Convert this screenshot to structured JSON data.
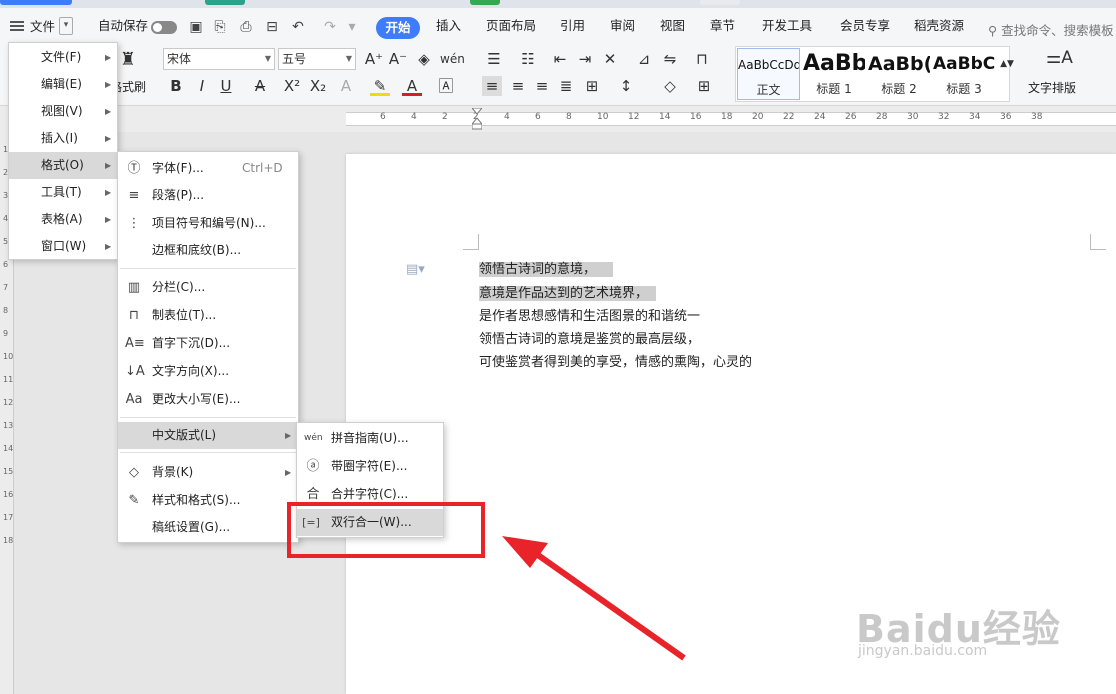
{
  "menubar": {
    "file_label": "文件",
    "autosave_label": "自动保存",
    "tabs": [
      "开始",
      "插入",
      "页面布局",
      "引用",
      "审阅",
      "视图",
      "章节",
      "开发工具",
      "会员专享",
      "稻壳资源"
    ],
    "search_label": "查找命令、搜索模板"
  },
  "ribbon": {
    "format_brush_label": "格式刷",
    "font_name": "宋体",
    "font_size": "五号",
    "styles": [
      {
        "preview": "AaBbCcDd",
        "label": "正文"
      },
      {
        "preview": "AaBb",
        "label": "标题 1"
      },
      {
        "preview": "AaBb(",
        "label": "标题 2"
      },
      {
        "preview": "AaBbC",
        "label": "标题 3"
      }
    ],
    "text_layout_label": "文字排版"
  },
  "ruler": {
    "top_numbers": [
      "6",
      "4",
      "2",
      "2",
      "4",
      "6",
      "8",
      "10",
      "12",
      "14",
      "16",
      "18",
      "20",
      "22",
      "24",
      "26",
      "28",
      "30",
      "32",
      "34",
      "36",
      "38"
    ],
    "left_numbers": [
      "1",
      "2",
      "3",
      "4",
      "5",
      "6",
      "7",
      "8",
      "9",
      "10",
      "11",
      "12",
      "13",
      "14",
      "15",
      "16",
      "17",
      "18"
    ]
  },
  "document": {
    "lines": [
      "领悟古诗词的意境，",
      "意境是作品达到的艺术境界，",
      "是作者思想感情和生活图景的和谐统一",
      "领悟古诗词的意境是鉴赏的最高层级，",
      "可使鉴赏者得到美的享受，情感的熏陶，心灵的"
    ]
  },
  "main_menu": {
    "items": [
      "文件(F)",
      "编辑(E)",
      "视图(V)",
      "插入(I)",
      "格式(O)",
      "工具(T)",
      "表格(A)",
      "窗口(W)"
    ]
  },
  "format_menu": {
    "items": [
      {
        "label": "字体(F)...",
        "shortcut": "Ctrl+D",
        "icon": "T"
      },
      {
        "label": "段落(P)...",
        "icon": "≡"
      },
      {
        "label": "项目符号和编号(N)...",
        "icon": "⋮≡"
      },
      {
        "label": "边框和底纹(B)...",
        "icon": ""
      },
      {
        "label": "分栏(C)...",
        "icon": "▥"
      },
      {
        "label": "制表位(T)...",
        "icon": "⊓"
      },
      {
        "label": "首字下沉(D)...",
        "icon": "A≡"
      },
      {
        "label": "文字方向(X)...",
        "icon": "↓A"
      },
      {
        "label": "更改大小写(E)...",
        "icon": "Aa"
      },
      {
        "label": "中文版式(L)",
        "icon": ""
      },
      {
        "label": "背景(K)",
        "icon": "◇"
      },
      {
        "label": "样式和格式(S)...",
        "icon": "✎"
      },
      {
        "label": "稿纸设置(G)...",
        "icon": ""
      }
    ]
  },
  "chinese_layout_menu": {
    "items": [
      {
        "label": "拼音指南(U)...",
        "icon": "wén"
      },
      {
        "label": "带圈字符(E)...",
        "icon": "ⓐ"
      },
      {
        "label": "合并字符(C)...",
        "icon": "合"
      },
      {
        "label": "双行合一(W)...",
        "icon": "[=]"
      }
    ]
  },
  "watermark": {
    "brand": "Baidu经验",
    "url": "jingyan.baidu.com"
  },
  "colors": {
    "accent": "#3d7dfa",
    "highlight_box": "#e8242a",
    "selection": "#cfcfcf"
  }
}
